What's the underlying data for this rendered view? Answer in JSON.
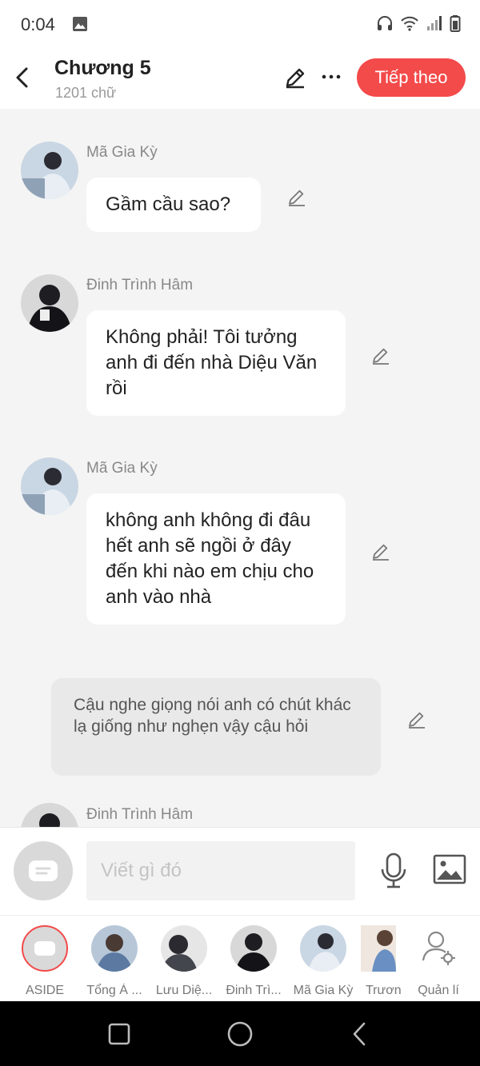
{
  "status_bar": {
    "time": "0:04",
    "icons": [
      "gallery-icon",
      "headphones-icon",
      "wifi-icon",
      "signal-icon",
      "battery-icon"
    ]
  },
  "header": {
    "title": "Chương 5",
    "subtitle": "1201 chữ",
    "next_label": "Tiếp theo",
    "accent_color": "#f34a4a"
  },
  "messages": [
    {
      "type": "character",
      "name": "Mã Gia Kỳ",
      "text": "Gầm cầu sao?"
    },
    {
      "type": "character",
      "name": "Đinh Trình Hâm",
      "text": "Không phải! Tôi tưởng anh đi đến nhà Diệu Văn rồi"
    },
    {
      "type": "character",
      "name": "Mã Gia Kỳ",
      "text": "không anh không đi đâu hết anh sẽ ngồi ở đây đến khi nào em chịu cho anh vào nhà"
    },
    {
      "type": "narration",
      "text": "Cậu nghe giọng nói anh có chút khác lạ giống như nghẹn vậy cậu hỏi"
    },
    {
      "type": "character",
      "name": "Đinh Trình Hâm",
      "text": ""
    }
  ],
  "input": {
    "placeholder": "Viết gì đó"
  },
  "characters": [
    {
      "label": "ASIDE"
    },
    {
      "label": "Tổng Á ..."
    },
    {
      "label": "Lưu Diệ..."
    },
    {
      "label": "Đinh Trì..."
    },
    {
      "label": "Mã Gia Kỳ"
    },
    {
      "label": "Trươn"
    },
    {
      "label": "Quản lí"
    }
  ]
}
